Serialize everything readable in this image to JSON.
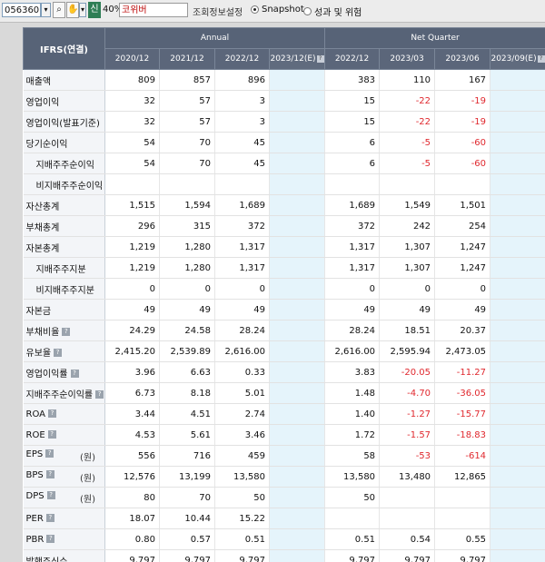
{
  "toolbar": {
    "code_value": "056360",
    "dropdown_glyph": "▾",
    "search_glyph": "⌕",
    "tool_glyph": "✋",
    "new_label": "신",
    "zoom_label": "40%",
    "company_name": "코위버",
    "view_label": "조회정보설정",
    "radio_snapshot": "Snapshot",
    "radio_perf": "성과 및 위험",
    "selected_view": "Snapshot"
  },
  "table": {
    "corner_label": "IFRS(연결)",
    "group_annual": "Annual",
    "group_quarter": "Net Quarter",
    "columns": [
      "2020/12",
      "2021/12",
      "2022/12",
      "2023/12(E)",
      "2022/12",
      "2023/03",
      "2023/06",
      "2023/09(E)"
    ],
    "est_icon": "?",
    "rows": [
      {
        "label": "매출액",
        "indent": false,
        "info": false,
        "unit": "",
        "values": [
          "809",
          "857",
          "896",
          "",
          "383",
          "110",
          "167",
          ""
        ]
      },
      {
        "label": "영업이익",
        "indent": false,
        "info": false,
        "unit": "",
        "values": [
          "32",
          "57",
          "3",
          "",
          "15",
          "-22",
          "-19",
          ""
        ]
      },
      {
        "label": "영업이익(발표기준)",
        "indent": false,
        "info": false,
        "unit": "",
        "values": [
          "32",
          "57",
          "3",
          "",
          "15",
          "-22",
          "-19",
          ""
        ]
      },
      {
        "label": "당기순이익",
        "indent": false,
        "info": false,
        "unit": "",
        "values": [
          "54",
          "70",
          "45",
          "",
          "6",
          "-5",
          "-60",
          ""
        ]
      },
      {
        "label": "지배주주순이익",
        "indent": true,
        "info": false,
        "unit": "",
        "values": [
          "54",
          "70",
          "45",
          "",
          "6",
          "-5",
          "-60",
          ""
        ]
      },
      {
        "label": "비지배주주순이익",
        "indent": true,
        "info": false,
        "unit": "",
        "values": [
          "",
          "",
          "",
          "",
          "",
          "",
          "",
          ""
        ]
      },
      {
        "label": "자산총계",
        "indent": false,
        "info": false,
        "unit": "",
        "values": [
          "1,515",
          "1,594",
          "1,689",
          "",
          "1,689",
          "1,549",
          "1,501",
          ""
        ]
      },
      {
        "label": "부채총계",
        "indent": false,
        "info": false,
        "unit": "",
        "values": [
          "296",
          "315",
          "372",
          "",
          "372",
          "242",
          "254",
          ""
        ]
      },
      {
        "label": "자본총계",
        "indent": false,
        "info": false,
        "unit": "",
        "values": [
          "1,219",
          "1,280",
          "1,317",
          "",
          "1,317",
          "1,307",
          "1,247",
          ""
        ]
      },
      {
        "label": "지배주주지분",
        "indent": true,
        "info": false,
        "unit": "",
        "values": [
          "1,219",
          "1,280",
          "1,317",
          "",
          "1,317",
          "1,307",
          "1,247",
          ""
        ]
      },
      {
        "label": "비지배주주지분",
        "indent": true,
        "info": false,
        "unit": "",
        "values": [
          "0",
          "0",
          "0",
          "",
          "0",
          "0",
          "0",
          ""
        ]
      },
      {
        "label": "자본금",
        "indent": false,
        "info": false,
        "unit": "",
        "values": [
          "49",
          "49",
          "49",
          "",
          "49",
          "49",
          "49",
          ""
        ]
      },
      {
        "label": "부채비율",
        "indent": false,
        "info": true,
        "unit": "",
        "values": [
          "24.29",
          "24.58",
          "28.24",
          "",
          "28.24",
          "18.51",
          "20.37",
          ""
        ]
      },
      {
        "label": "유보율",
        "indent": false,
        "info": true,
        "unit": "",
        "values": [
          "2,415.20",
          "2,539.89",
          "2,616.00",
          "",
          "2,616.00",
          "2,595.94",
          "2,473.05",
          ""
        ]
      },
      {
        "label": "영업이익률",
        "indent": false,
        "info": true,
        "unit": "",
        "values": [
          "3.96",
          "6.63",
          "0.33",
          "",
          "3.83",
          "-20.05",
          "-11.27",
          ""
        ]
      },
      {
        "label": "지배주주순이익률",
        "indent": false,
        "info": true,
        "unit": "",
        "values": [
          "6.73",
          "8.18",
          "5.01",
          "",
          "1.48",
          "-4.70",
          "-36.05",
          ""
        ]
      },
      {
        "label": "ROA",
        "indent": false,
        "info": true,
        "unit": "",
        "values": [
          "3.44",
          "4.51",
          "2.74",
          "",
          "1.40",
          "-1.27",
          "-15.77",
          ""
        ]
      },
      {
        "label": "ROE",
        "indent": false,
        "info": true,
        "unit": "",
        "values": [
          "4.53",
          "5.61",
          "3.46",
          "",
          "1.72",
          "-1.57",
          "-18.83",
          ""
        ]
      },
      {
        "label": "EPS",
        "indent": false,
        "info": true,
        "unit": "(원)",
        "values": [
          "556",
          "716",
          "459",
          "",
          "58",
          "-53",
          "-614",
          ""
        ]
      },
      {
        "label": "BPS",
        "indent": false,
        "info": true,
        "unit": "(원)",
        "values": [
          "12,576",
          "13,199",
          "13,580",
          "",
          "13,580",
          "13,480",
          "12,865",
          ""
        ]
      },
      {
        "label": "DPS",
        "indent": false,
        "info": true,
        "unit": "(원)",
        "values": [
          "80",
          "70",
          "50",
          "",
          "50",
          "",
          "",
          ""
        ]
      },
      {
        "label": "PER",
        "indent": false,
        "info": true,
        "unit": "",
        "values": [
          "18.07",
          "10.44",
          "15.22",
          "",
          "",
          "",
          "",
          ""
        ]
      },
      {
        "label": "PBR",
        "indent": false,
        "info": true,
        "unit": "",
        "values": [
          "0.80",
          "0.57",
          "0.51",
          "",
          "0.51",
          "0.54",
          "0.55",
          ""
        ]
      },
      {
        "label": "발행주식수",
        "indent": false,
        "info": false,
        "unit": "",
        "values": [
          "9,797",
          "9,797",
          "9,797",
          "",
          "9,797",
          "9,797",
          "9,797",
          ""
        ]
      }
    ]
  },
  "colors": {
    "header_bg": "#576377",
    "estimate_bg": "#e5f4fb",
    "negative": "#e0282e",
    "label_bg": "#f3f5f8"
  }
}
